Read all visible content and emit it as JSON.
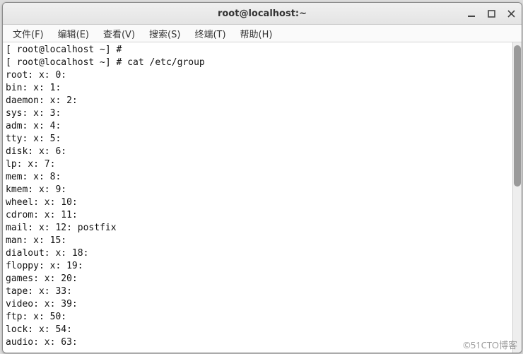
{
  "window": {
    "title": "root@localhost:~"
  },
  "menu": {
    "file": "文件(F)",
    "edit": "编辑(E)",
    "view": "查看(V)",
    "search": "搜索(S)",
    "terminal": "终端(T)",
    "help": "帮助(H)"
  },
  "prompt1": "[ root@localhost ~] # ",
  "prompt2": "[ root@localhost ~] # ",
  "command": "cat /etc/group",
  "groups": [
    {
      "name": "root",
      "x": "x",
      "gid": "0",
      "members": ""
    },
    {
      "name": "bin",
      "x": "x",
      "gid": "1",
      "members": ""
    },
    {
      "name": "daemon",
      "x": "x",
      "gid": "2",
      "members": ""
    },
    {
      "name": "sys",
      "x": "x",
      "gid": "3",
      "members": ""
    },
    {
      "name": "adm",
      "x": "x",
      "gid": "4",
      "members": ""
    },
    {
      "name": "tty",
      "x": "x",
      "gid": "5",
      "members": ""
    },
    {
      "name": "disk",
      "x": "x",
      "gid": "6",
      "members": ""
    },
    {
      "name": "lp",
      "x": "x",
      "gid": "7",
      "members": ""
    },
    {
      "name": "mem",
      "x": "x",
      "gid": "8",
      "members": ""
    },
    {
      "name": "kmem",
      "x": "x",
      "gid": "9",
      "members": ""
    },
    {
      "name": "wheel",
      "x": "x",
      "gid": "10",
      "members": ""
    },
    {
      "name": "cdrom",
      "x": "x",
      "gid": "11",
      "members": ""
    },
    {
      "name": "mail",
      "x": "x",
      "gid": "12",
      "members": "postfix"
    },
    {
      "name": "man",
      "x": "x",
      "gid": "15",
      "members": ""
    },
    {
      "name": "dialout",
      "x": "x",
      "gid": "18",
      "members": ""
    },
    {
      "name": "floppy",
      "x": "x",
      "gid": "19",
      "members": ""
    },
    {
      "name": "games",
      "x": "x",
      "gid": "20",
      "members": ""
    },
    {
      "name": "tape",
      "x": "x",
      "gid": "33",
      "members": ""
    },
    {
      "name": "video",
      "x": "x",
      "gid": "39",
      "members": ""
    },
    {
      "name": "ftp",
      "x": "x",
      "gid": "50",
      "members": ""
    },
    {
      "name": "lock",
      "x": "x",
      "gid": "54",
      "members": ""
    },
    {
      "name": "audio",
      "x": "x",
      "gid": "63",
      "members": ""
    }
  ],
  "watermark": "©51CTO博客"
}
